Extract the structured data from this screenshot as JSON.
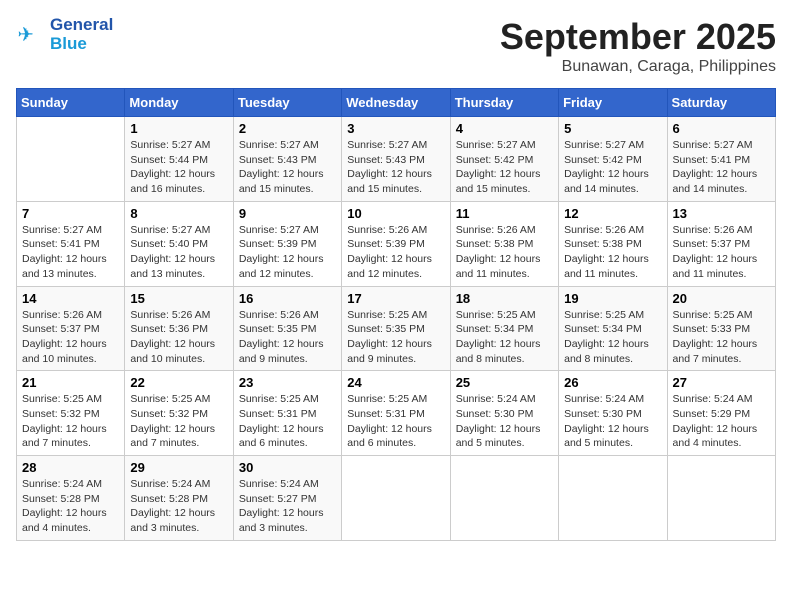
{
  "header": {
    "logo_line1": "General",
    "logo_line2": "Blue",
    "month": "September 2025",
    "location": "Bunawan, Caraga, Philippines"
  },
  "days_of_week": [
    "Sunday",
    "Monday",
    "Tuesday",
    "Wednesday",
    "Thursday",
    "Friday",
    "Saturday"
  ],
  "weeks": [
    [
      {
        "day": "",
        "info": ""
      },
      {
        "day": "1",
        "info": "Sunrise: 5:27 AM\nSunset: 5:44 PM\nDaylight: 12 hours\nand 16 minutes."
      },
      {
        "day": "2",
        "info": "Sunrise: 5:27 AM\nSunset: 5:43 PM\nDaylight: 12 hours\nand 15 minutes."
      },
      {
        "day": "3",
        "info": "Sunrise: 5:27 AM\nSunset: 5:43 PM\nDaylight: 12 hours\nand 15 minutes."
      },
      {
        "day": "4",
        "info": "Sunrise: 5:27 AM\nSunset: 5:42 PM\nDaylight: 12 hours\nand 15 minutes."
      },
      {
        "day": "5",
        "info": "Sunrise: 5:27 AM\nSunset: 5:42 PM\nDaylight: 12 hours\nand 14 minutes."
      },
      {
        "day": "6",
        "info": "Sunrise: 5:27 AM\nSunset: 5:41 PM\nDaylight: 12 hours\nand 14 minutes."
      }
    ],
    [
      {
        "day": "7",
        "info": "Sunrise: 5:27 AM\nSunset: 5:41 PM\nDaylight: 12 hours\nand 13 minutes."
      },
      {
        "day": "8",
        "info": "Sunrise: 5:27 AM\nSunset: 5:40 PM\nDaylight: 12 hours\nand 13 minutes."
      },
      {
        "day": "9",
        "info": "Sunrise: 5:27 AM\nSunset: 5:39 PM\nDaylight: 12 hours\nand 12 minutes."
      },
      {
        "day": "10",
        "info": "Sunrise: 5:26 AM\nSunset: 5:39 PM\nDaylight: 12 hours\nand 12 minutes."
      },
      {
        "day": "11",
        "info": "Sunrise: 5:26 AM\nSunset: 5:38 PM\nDaylight: 12 hours\nand 11 minutes."
      },
      {
        "day": "12",
        "info": "Sunrise: 5:26 AM\nSunset: 5:38 PM\nDaylight: 12 hours\nand 11 minutes."
      },
      {
        "day": "13",
        "info": "Sunrise: 5:26 AM\nSunset: 5:37 PM\nDaylight: 12 hours\nand 11 minutes."
      }
    ],
    [
      {
        "day": "14",
        "info": "Sunrise: 5:26 AM\nSunset: 5:37 PM\nDaylight: 12 hours\nand 10 minutes."
      },
      {
        "day": "15",
        "info": "Sunrise: 5:26 AM\nSunset: 5:36 PM\nDaylight: 12 hours\nand 10 minutes."
      },
      {
        "day": "16",
        "info": "Sunrise: 5:26 AM\nSunset: 5:35 PM\nDaylight: 12 hours\nand 9 minutes."
      },
      {
        "day": "17",
        "info": "Sunrise: 5:25 AM\nSunset: 5:35 PM\nDaylight: 12 hours\nand 9 minutes."
      },
      {
        "day": "18",
        "info": "Sunrise: 5:25 AM\nSunset: 5:34 PM\nDaylight: 12 hours\nand 8 minutes."
      },
      {
        "day": "19",
        "info": "Sunrise: 5:25 AM\nSunset: 5:34 PM\nDaylight: 12 hours\nand 8 minutes."
      },
      {
        "day": "20",
        "info": "Sunrise: 5:25 AM\nSunset: 5:33 PM\nDaylight: 12 hours\nand 7 minutes."
      }
    ],
    [
      {
        "day": "21",
        "info": "Sunrise: 5:25 AM\nSunset: 5:32 PM\nDaylight: 12 hours\nand 7 minutes."
      },
      {
        "day": "22",
        "info": "Sunrise: 5:25 AM\nSunset: 5:32 PM\nDaylight: 12 hours\nand 7 minutes."
      },
      {
        "day": "23",
        "info": "Sunrise: 5:25 AM\nSunset: 5:31 PM\nDaylight: 12 hours\nand 6 minutes."
      },
      {
        "day": "24",
        "info": "Sunrise: 5:25 AM\nSunset: 5:31 PM\nDaylight: 12 hours\nand 6 minutes."
      },
      {
        "day": "25",
        "info": "Sunrise: 5:24 AM\nSunset: 5:30 PM\nDaylight: 12 hours\nand 5 minutes."
      },
      {
        "day": "26",
        "info": "Sunrise: 5:24 AM\nSunset: 5:30 PM\nDaylight: 12 hours\nand 5 minutes."
      },
      {
        "day": "27",
        "info": "Sunrise: 5:24 AM\nSunset: 5:29 PM\nDaylight: 12 hours\nand 4 minutes."
      }
    ],
    [
      {
        "day": "28",
        "info": "Sunrise: 5:24 AM\nSunset: 5:28 PM\nDaylight: 12 hours\nand 4 minutes."
      },
      {
        "day": "29",
        "info": "Sunrise: 5:24 AM\nSunset: 5:28 PM\nDaylight: 12 hours\nand 3 minutes."
      },
      {
        "day": "30",
        "info": "Sunrise: 5:24 AM\nSunset: 5:27 PM\nDaylight: 12 hours\nand 3 minutes."
      },
      {
        "day": "",
        "info": ""
      },
      {
        "day": "",
        "info": ""
      },
      {
        "day": "",
        "info": ""
      },
      {
        "day": "",
        "info": ""
      }
    ]
  ]
}
